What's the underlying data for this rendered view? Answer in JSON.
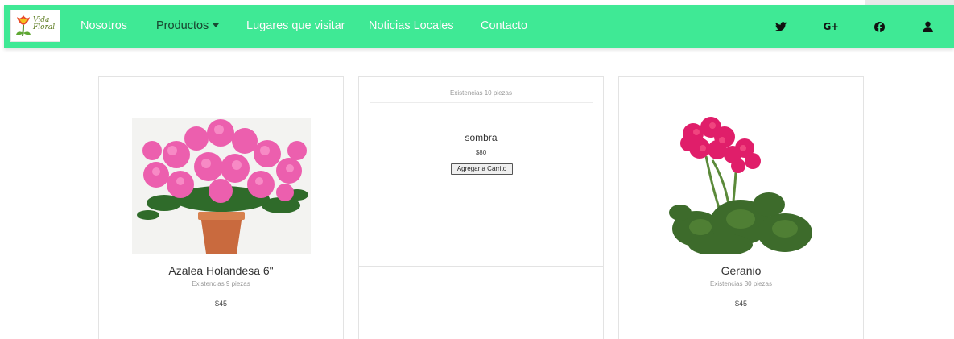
{
  "colors": {
    "navbar": "#3fe995",
    "card_border": "#e3e3e3"
  },
  "logo": {
    "text": "Vida Floral",
    "icon": "tulip-logo-icon"
  },
  "nav": {
    "items": [
      {
        "label": "Nosotros"
      },
      {
        "label": "Productos",
        "has_dropdown": true
      },
      {
        "label": "Lugares que visitar"
      },
      {
        "label": "Noticias Locales"
      },
      {
        "label": "Contacto"
      }
    ],
    "social": [
      "twitter-icon",
      "google-plus-icon",
      "facebook-icon",
      "user-icon"
    ],
    "gplus_glyph": "G+"
  },
  "products": [
    {
      "name": "Azalea Holandesa 6\"",
      "stock": "Existencias 9 piezas",
      "price": "$45",
      "image": "pink-azalea-pot-image"
    },
    {
      "stock": "Existencias 10 piezas",
      "name": "sombra",
      "price": "$80",
      "button": "Agregar a Carrito"
    },
    {
      "name": "Geranio",
      "stock": "Existencias 30 piezas",
      "price": "$45",
      "image": "pink-geranium-image"
    }
  ]
}
